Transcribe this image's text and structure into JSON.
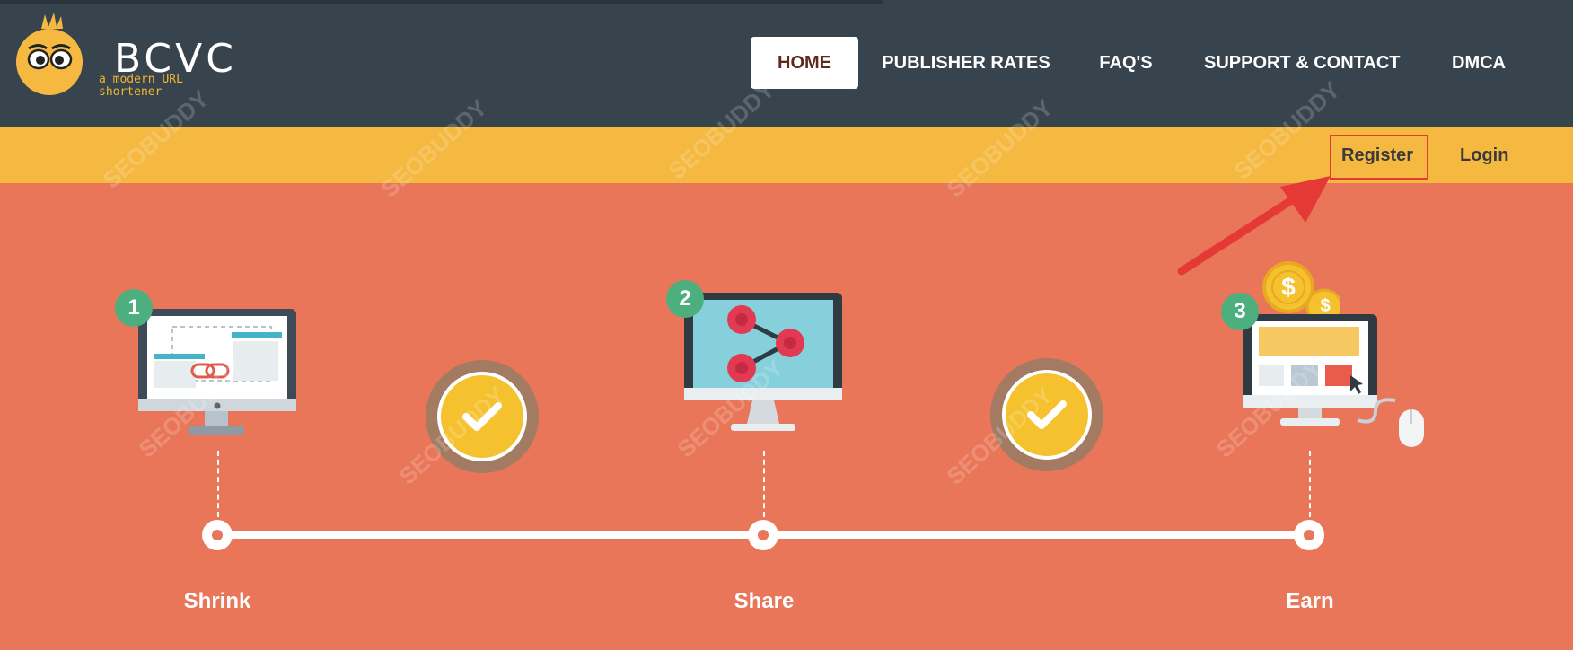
{
  "brand": {
    "name": "BCVC",
    "tagline": "a modern URL shortener"
  },
  "nav": {
    "items": [
      {
        "label": "HOME",
        "active": true
      },
      {
        "label": "PUBLISHER RATES"
      },
      {
        "label": "FAQ'S"
      },
      {
        "label": "SUPPORT & CONTACT"
      },
      {
        "label": "DMCA"
      }
    ]
  },
  "subnav": {
    "register_label": "Register",
    "login_label": "Login"
  },
  "steps": [
    {
      "number": "1",
      "label": "Shrink"
    },
    {
      "number": "2",
      "label": "Share"
    },
    {
      "number": "3",
      "label": "Earn"
    }
  ],
  "coins": {
    "symbol": "$"
  },
  "watermark": {
    "text": "SEOBUDDY"
  },
  "colors": {
    "header_bg": "#37444d",
    "subbar_bg": "#f5b941",
    "hero_bg": "#e97658",
    "step_badge": "#4caf7d",
    "highlight": "#e53935"
  }
}
